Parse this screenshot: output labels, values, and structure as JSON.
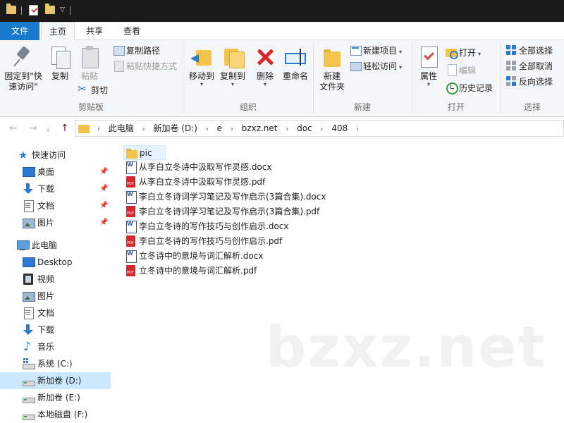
{
  "tabs": {
    "file": "文件",
    "home": "主页",
    "share": "共享",
    "view": "查看"
  },
  "ribbon": {
    "clipboard": {
      "group_label": "剪贴板",
      "pin_label_line1": "固定到\"快",
      "pin_label_line2": "速访问\"",
      "copy_label": "复制",
      "paste_label": "粘贴",
      "copy_path": "复制路径",
      "paste_shortcut": "粘贴快捷方式",
      "cut": "剪切"
    },
    "organize": {
      "group_label": "组织",
      "move_to": "移动到",
      "copy_to": "复制到",
      "delete": "删除",
      "rename": "重命名"
    },
    "new": {
      "group_label": "新建",
      "new_folder_line1": "新建",
      "new_folder_line2": "文件夹",
      "new_item": "新建项目",
      "easy_access": "轻松访问"
    },
    "open": {
      "group_label": "打开",
      "properties": "属性",
      "open": "打开",
      "edit": "编辑",
      "history": "历史记录"
    },
    "select": {
      "group_label": "选择",
      "select_all": "全部选择",
      "select_none": "全部取消",
      "invert": "反向选择"
    }
  },
  "address": {
    "crumbs": [
      "此电脑",
      "新加卷 (D:)",
      "e",
      "bzxz.net",
      "doc",
      "408"
    ]
  },
  "nav": {
    "quick_access": "快速访问",
    "qa_desktop": "桌面",
    "qa_downloads": "下载",
    "qa_documents": "文档",
    "qa_pictures": "图片",
    "this_pc": "此电脑",
    "pc_desktop": "Desktop",
    "pc_videos": "视频",
    "pc_pictures": "图片",
    "pc_documents": "文档",
    "pc_downloads": "下载",
    "pc_music": "音乐",
    "drive_c": "系统 (C:)",
    "drive_d": "新加卷 (D:)",
    "drive_e": "新加卷 (E:)",
    "drive_f": "本地磁盘 (F:)"
  },
  "files": [
    {
      "name": "pic",
      "type": "folder"
    },
    {
      "name": "从李白立冬诗中汲取写作灵感.docx",
      "type": "word"
    },
    {
      "name": "从李白立冬诗中汲取写作灵感.pdf",
      "type": "pdf"
    },
    {
      "name": "李白立冬诗词学习笔记及写作启示(3篇合集).docx",
      "type": "word"
    },
    {
      "name": "李白立冬诗词学习笔记及写作启示(3篇合集).pdf",
      "type": "pdf"
    },
    {
      "name": "李白立冬诗的写作技巧与创作启示.docx",
      "type": "word"
    },
    {
      "name": "李白立冬诗的写作技巧与创作启示.pdf",
      "type": "pdf"
    },
    {
      "name": "立冬诗中的意境与词汇解析.docx",
      "type": "word"
    },
    {
      "name": "立冬诗中的意境与词汇解析.pdf",
      "type": "pdf"
    }
  ],
  "watermark": "bzxz.net"
}
